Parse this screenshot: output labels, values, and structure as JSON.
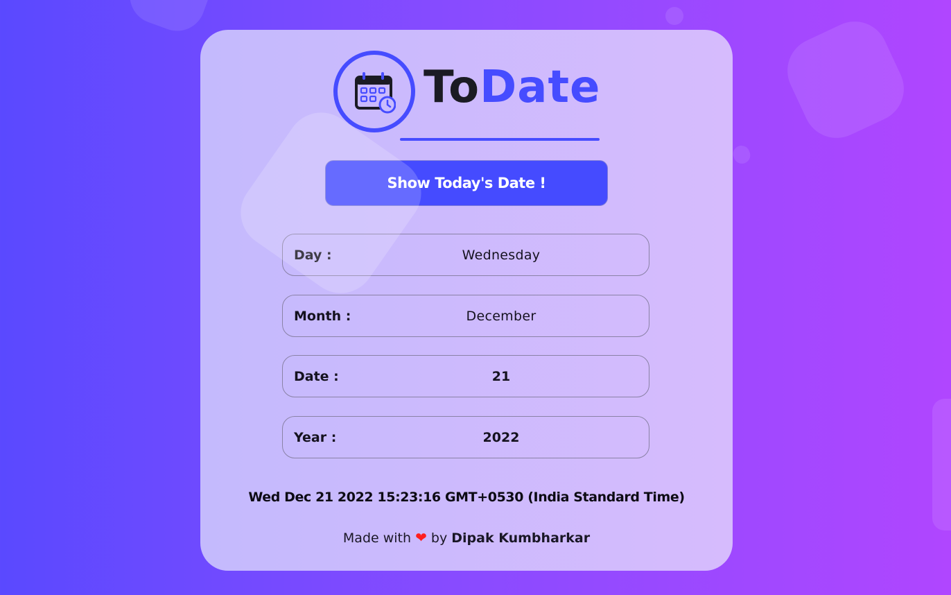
{
  "app": {
    "logo_to": "To",
    "logo_date": "Date"
  },
  "button": {
    "label": "Show Today's Date !"
  },
  "fields": {
    "day": {
      "label": "Day :",
      "value": "Wednesday"
    },
    "month": {
      "label": "Month :",
      "value": "December"
    },
    "date": {
      "label": "Date :",
      "value": "21"
    },
    "year": {
      "label": "Year :",
      "value": "2022"
    }
  },
  "full_date": "Wed Dec 21 2022 15:23:16 GMT+0530 (India Standard Time)",
  "footer": {
    "made_with": "Made with",
    "heart": "❤",
    "by": "by",
    "author": "Dipak Kumbharkar"
  },
  "icons": {
    "logo_icon": "calendar-clock-icon"
  },
  "colors": {
    "accent": "#464cff",
    "heart": "#ff1e1e"
  }
}
